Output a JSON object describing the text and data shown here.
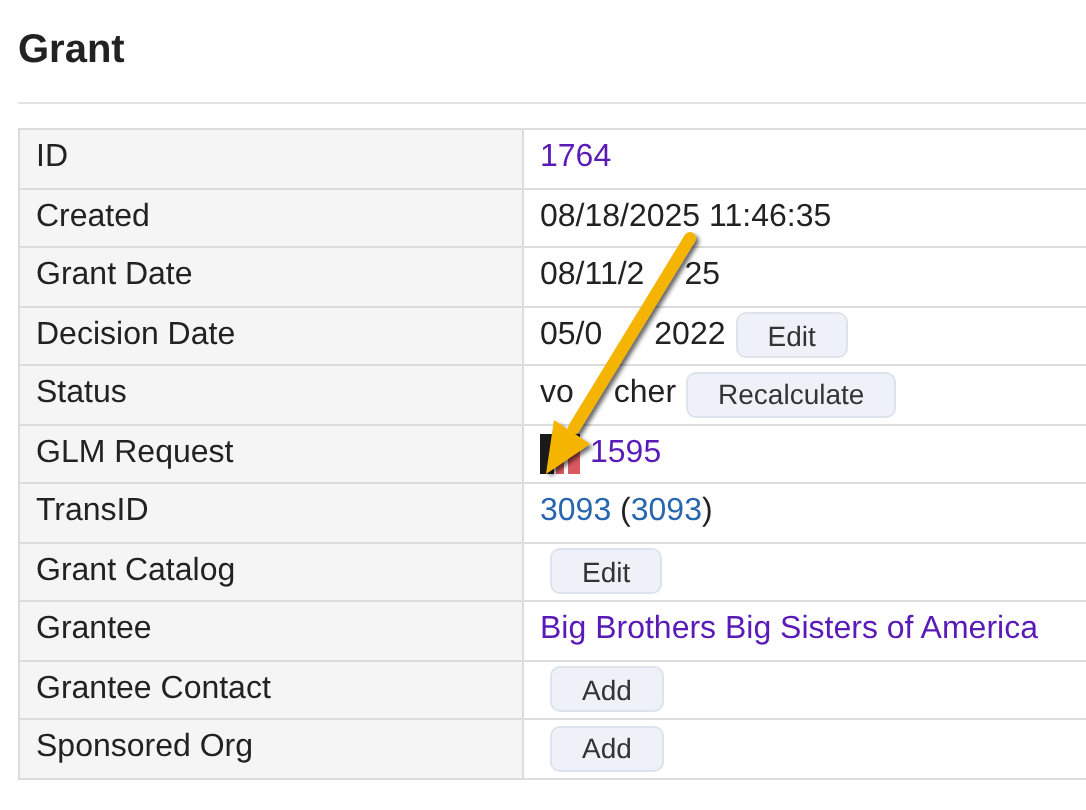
{
  "title": "Grant",
  "rows": [
    {
      "label": "ID",
      "parts": [
        {
          "kind": "link",
          "visited": true,
          "text": "1764"
        }
      ]
    },
    {
      "label": "Created",
      "parts": [
        {
          "kind": "text",
          "text": "08/18/2025 11:46:35"
        }
      ]
    },
    {
      "label": "Grant Date",
      "parts": [
        {
          "kind": "text",
          "text": "08/11/2"
        },
        {
          "kind": "gap"
        },
        {
          "kind": "text",
          "text": "25"
        }
      ]
    },
    {
      "label": "Decision Date",
      "parts": [
        {
          "kind": "text",
          "text": "05/0"
        },
        {
          "kind": "wide-gap"
        },
        {
          "kind": "text",
          "text": "2022"
        },
        {
          "kind": "button",
          "text": "Edit"
        }
      ]
    },
    {
      "label": "Status",
      "parts": [
        {
          "kind": "text",
          "text": "vo"
        },
        {
          "kind": "gap"
        },
        {
          "kind": "text",
          "text": "cher"
        },
        {
          "kind": "button",
          "text": "Recalculate"
        }
      ]
    },
    {
      "label": "GLM Request",
      "parts": [
        {
          "kind": "icon"
        },
        {
          "kind": "link",
          "visited": true,
          "text": "1595"
        }
      ]
    },
    {
      "label": "TransID",
      "parts": [
        {
          "kind": "link",
          "visited": false,
          "text": "3093"
        },
        {
          "kind": "text",
          "text": " ("
        },
        {
          "kind": "link",
          "visited": false,
          "text": "3093"
        },
        {
          "kind": "text",
          "text": ")"
        }
      ]
    },
    {
      "label": "Grant Catalog",
      "parts": [
        {
          "kind": "button",
          "text": "Edit"
        }
      ]
    },
    {
      "label": "Grantee",
      "parts": [
        {
          "kind": "link",
          "visited": true,
          "text": "Big Brothers Big Sisters of America"
        }
      ]
    },
    {
      "label": "Grantee Contact",
      "parts": [
        {
          "kind": "button",
          "text": "Add"
        }
      ]
    },
    {
      "label": "Sponsored Org",
      "parts": [
        {
          "kind": "button",
          "text": "Add"
        }
      ]
    }
  ]
}
